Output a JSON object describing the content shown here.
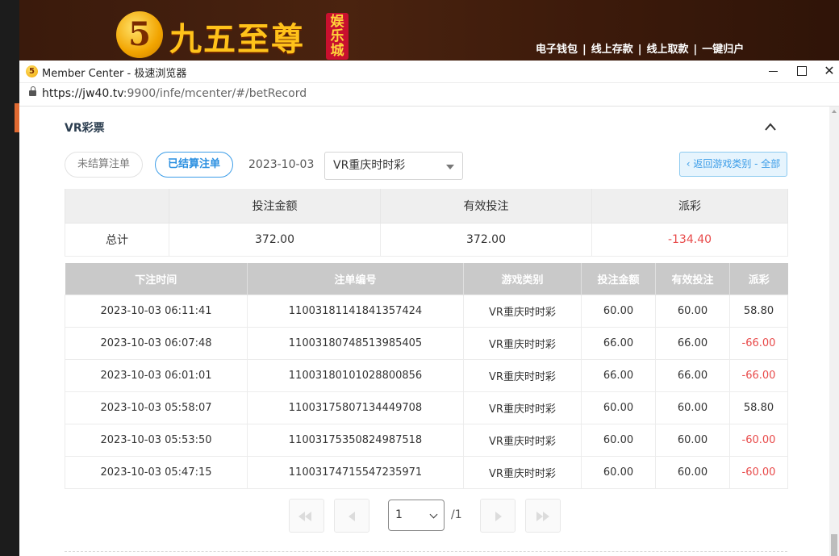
{
  "site": {
    "logo_digit": "5",
    "logo_text": "九五至尊",
    "logo_side": "娱乐城",
    "nav": [
      "电子钱包",
      "线上存款",
      "线上取款",
      "一键归户"
    ]
  },
  "browser": {
    "title": "Member Center - 极速浏览器",
    "url_host": "https://jw40.tv",
    "url_path": ":9900/infe/mcenter/#/betRecord"
  },
  "section": {
    "title": "VR彩票",
    "tabs": {
      "unsettled": "未结算注单",
      "settled": "已结算注单"
    },
    "date": "2023-10-03",
    "game_select": "VR重庆时时彩",
    "back_label": "‹ 返回游戏类别 - 全部"
  },
  "summary": {
    "headers": [
      "",
      "投注金额",
      "有效投注",
      "派彩"
    ],
    "label": "总计",
    "bet_amount": "372.00",
    "valid_bet": "372.00",
    "payout": "-134.40"
  },
  "records": {
    "headers": [
      "下注时间",
      "注单编号",
      "游戏类别",
      "投注金额",
      "有效投注",
      "派彩"
    ],
    "rows": [
      {
        "time": "2023-10-03 06:11:41",
        "id": "11003181141841357424",
        "game": "VR重庆时时彩",
        "bet": "60.00",
        "valid": "60.00",
        "payout": "58.80"
      },
      {
        "time": "2023-10-03 06:07:48",
        "id": "11003180748513985405",
        "game": "VR重庆时时彩",
        "bet": "66.00",
        "valid": "66.00",
        "payout": "-66.00"
      },
      {
        "time": "2023-10-03 06:01:01",
        "id": "11003180101028800856",
        "game": "VR重庆时时彩",
        "bet": "66.00",
        "valid": "66.00",
        "payout": "-66.00"
      },
      {
        "time": "2023-10-03 05:58:07",
        "id": "11003175807134449708",
        "game": "VR重庆时时彩",
        "bet": "60.00",
        "valid": "60.00",
        "payout": "58.80"
      },
      {
        "time": "2023-10-03 05:53:50",
        "id": "11003175350824987518",
        "game": "VR重庆时时彩",
        "bet": "60.00",
        "valid": "60.00",
        "payout": "-60.00"
      },
      {
        "time": "2023-10-03 05:47:15",
        "id": "11003174715547235971",
        "game": "VR重庆时时彩",
        "bet": "60.00",
        "valid": "60.00",
        "payout": "-60.00"
      }
    ]
  },
  "pagination": {
    "current": "1",
    "total": "/1"
  },
  "colors": {
    "accent_blue": "#3c9de8",
    "negative_red": "#e84a4a",
    "header_gray": "#c9c9c9"
  }
}
